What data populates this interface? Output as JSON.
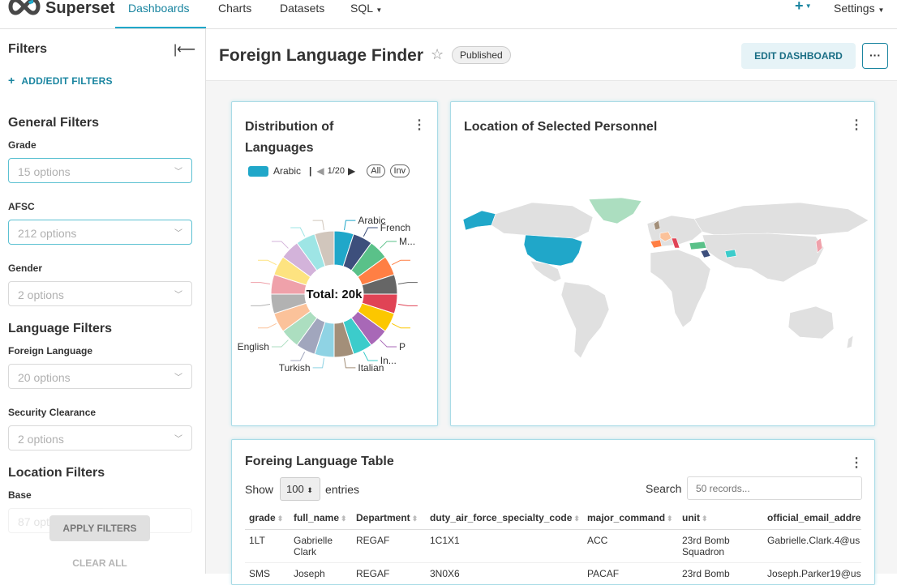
{
  "nav": {
    "brand": "Superset",
    "links": [
      "Dashboards",
      "Charts",
      "Datasets",
      "SQL"
    ],
    "plus": "+",
    "settings": "Settings"
  },
  "sidebar": {
    "title": "Filters",
    "add_edit": "ADD/EDIT FILTERS",
    "sections": {
      "general": "General Filters",
      "language": "Language Filters",
      "location": "Location Filters"
    },
    "filters": [
      {
        "label": "Grade",
        "placeholder": "15 options"
      },
      {
        "label": "AFSC",
        "placeholder": "212 options"
      },
      {
        "label": "Gender",
        "placeholder": "2 options"
      },
      {
        "label": "Foreign Language",
        "placeholder": "20 options"
      },
      {
        "label": "Security Clearance",
        "placeholder": "2 options"
      },
      {
        "label": "Base",
        "placeholder": "87 options"
      }
    ],
    "apply": "APPLY FILTERS",
    "clear": "CLEAR ALL"
  },
  "dashboard": {
    "title": "Foreign Language Finder",
    "status": "Published",
    "edit": "EDIT DASHBOARD",
    "more": "···"
  },
  "pie_card": {
    "title_line1": "Distribution of",
    "title_line2": "Languages",
    "legend_item": "Arabic",
    "legend_page": "1/20",
    "legend_all": "All",
    "legend_inv": "Inv",
    "total": "Total: 20k"
  },
  "map_card": {
    "title": "Location of Selected Personnel"
  },
  "table_card": {
    "title": "Foreing Language Table",
    "show": "Show",
    "entries_value": "100",
    "entries": "entries",
    "search": "Search",
    "search_placeholder": "50 records...",
    "columns": [
      "grade",
      "full_name",
      "Department",
      "duty_air_force_specialty_code",
      "major_command",
      "unit",
      "official_email_addre"
    ],
    "rows": [
      [
        "1LT",
        "Gabrielle Clark",
        "REGAF",
        "1C1X1",
        "ACC",
        "23rd Bomb Squadron",
        "Gabrielle.Clark.4@us"
      ],
      [
        "SMS",
        "Joseph",
        "REGAF",
        "3N0X6",
        "PACAF",
        "23rd Bomb",
        "Joseph.Parker19@us"
      ]
    ]
  },
  "chart_data": {
    "type": "pie",
    "center_label": "Total: 20k",
    "labels": [
      "Arabic",
      "French",
      "M...",
      "",
      "",
      "",
      "",
      "P",
      "In...",
      "Italian",
      "Turkish",
      "",
      "English",
      "",
      "",
      "",
      "",
      "",
      "",
      ""
    ],
    "values": [
      1,
      1,
      1,
      1,
      1,
      1,
      1,
      1,
      1,
      1,
      1,
      1,
      1,
      1,
      1,
      1,
      1,
      1,
      1,
      1
    ],
    "colors": [
      "#20a7c9",
      "#3d4f7c",
      "#5ac189",
      "#ff7f44",
      "#666666",
      "#e04355",
      "#fcc700",
      "#a868b7",
      "#3ccccb",
      "#a38f79",
      "#8fd3e4",
      "#a1a6bd",
      "#acdec0",
      "#fbc29a",
      "#b2b2b2",
      "#efa1aa",
      "#fde380",
      "#d3b3da",
      "#9ee5e5",
      "#d1c6bc"
    ]
  }
}
